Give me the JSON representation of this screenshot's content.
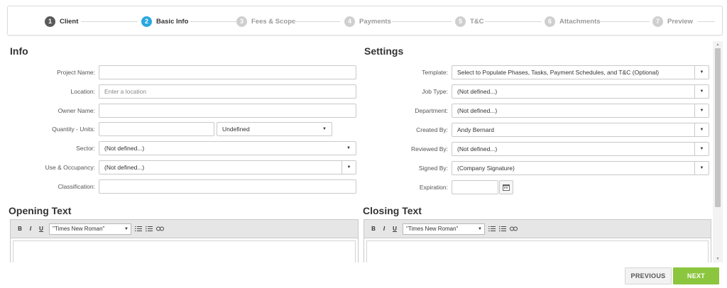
{
  "stepper": {
    "steps": [
      {
        "num": "1",
        "label": "Client",
        "state": "done"
      },
      {
        "num": "2",
        "label": "Basic Info",
        "state": "active"
      },
      {
        "num": "3",
        "label": "Fees & Scope",
        "state": "todo"
      },
      {
        "num": "4",
        "label": "Payments",
        "state": "todo"
      },
      {
        "num": "5",
        "label": "T&C",
        "state": "todo"
      },
      {
        "num": "6",
        "label": "Attachments",
        "state": "todo"
      },
      {
        "num": "7",
        "label": "Preview",
        "state": "todo"
      }
    ]
  },
  "info": {
    "title": "Info",
    "project_name": {
      "label": "Project Name:",
      "value": ""
    },
    "location": {
      "label": "Location:",
      "placeholder": "Enter a location"
    },
    "owner_name": {
      "label": "Owner Name:",
      "value": ""
    },
    "quantity": {
      "label": "Quantity - Units:",
      "value": "",
      "unit": "Undefined"
    },
    "sector": {
      "label": "Sector:",
      "value": "(Not defined...)"
    },
    "use_occupancy": {
      "label": "Use & Occupancy:",
      "value": "(Not defined...)"
    },
    "classification": {
      "label": "Classification:",
      "value": ""
    }
  },
  "settings": {
    "title": "Settings",
    "template": {
      "label": "Template:",
      "value": "Select to Populate Phases, Tasks, Payment Schedules, and T&C (Optional)"
    },
    "job_type": {
      "label": "Job Type:",
      "value": "(Not defined...)"
    },
    "department": {
      "label": "Department:",
      "value": "(Not defined...)"
    },
    "created_by": {
      "label": "Created By:",
      "value": "Andy Bernard"
    },
    "reviewed_by": {
      "label": "Reviewed By:",
      "value": "(Not defined...)"
    },
    "signed_by": {
      "label": "Signed By:",
      "value": "(Company Signature)"
    },
    "expiration": {
      "label": "Expiration:",
      "value": ""
    }
  },
  "opening_text": {
    "title": "Opening Text",
    "font": "\"Times New Roman\""
  },
  "closing_text": {
    "title": "Closing Text",
    "font": "\"Times New Roman\""
  },
  "toolbar": {
    "bold": "B",
    "italic": "I",
    "underline": "U"
  },
  "footer": {
    "previous": "PREVIOUS",
    "next": "NEXT"
  },
  "colors": {
    "active_step": "#29a8e0",
    "next_button": "#8cc63f"
  }
}
